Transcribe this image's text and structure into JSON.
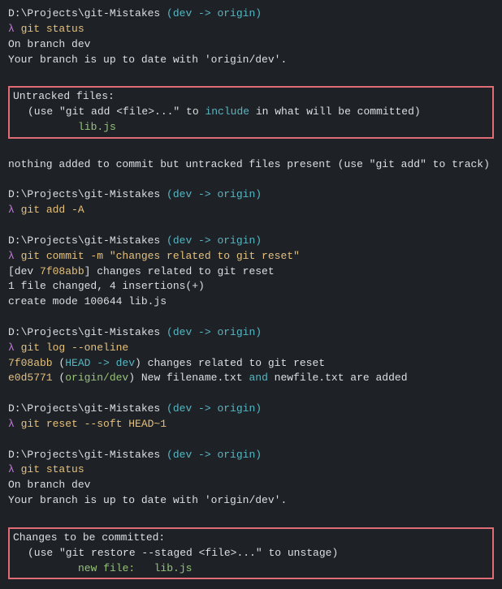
{
  "terminal": {
    "lines": [
      {
        "type": "prompt",
        "text": "D:\\Projects\\git-Mistakes (dev -> origin)"
      },
      {
        "type": "cmd",
        "text": "λ git status"
      },
      {
        "type": "normal",
        "text": "On branch dev"
      },
      {
        "type": "normal",
        "text": "Your branch is up to date with 'origin/dev'."
      },
      {
        "type": "blank"
      },
      {
        "type": "redbox_start",
        "text": "Untracked files:"
      },
      {
        "type": "redbox_line",
        "text": "  (use \"git add <file>...\" to include in what will be committed)"
      },
      {
        "type": "redbox_lib",
        "text": "        lib.js"
      },
      {
        "type": "redbox_end"
      },
      {
        "type": "blank"
      },
      {
        "type": "normal",
        "text": "nothing added to commit but untracked files present (use \"git add\" to track)"
      },
      {
        "type": "blank"
      },
      {
        "type": "prompt",
        "text": "D:\\Projects\\git-Mistakes (dev -> origin)"
      },
      {
        "type": "cmd",
        "text": "λ git add -A"
      },
      {
        "type": "blank"
      },
      {
        "type": "prompt",
        "text": "D:\\Projects\\git-Mistakes (dev -> origin)"
      },
      {
        "type": "cmd",
        "text": "λ git commit -m \"changes related to git reset\""
      },
      {
        "type": "normal",
        "text": "[dev 7f08abb] changes related to git reset"
      },
      {
        "type": "normal",
        "text": " 1 file changed, 4 insertions(+)"
      },
      {
        "type": "normal",
        "text": " create mode 100644 lib.js"
      },
      {
        "type": "blank"
      },
      {
        "type": "prompt",
        "text": "D:\\Projects\\git-Mistakes (dev -> origin)"
      },
      {
        "type": "cmd",
        "text": "λ git log --oneline"
      },
      {
        "type": "logline1",
        "text": "7f08abb (HEAD -> dev) changes related to git reset"
      },
      {
        "type": "logline2",
        "text": "e0d5771 (origin/dev) New filename.txt and newfile.txt are added"
      },
      {
        "type": "blank"
      },
      {
        "type": "prompt",
        "text": "D:\\Projects\\git-Mistakes (dev -> origin)"
      },
      {
        "type": "cmd",
        "text": "λ git reset --soft HEAD~1"
      },
      {
        "type": "blank"
      },
      {
        "type": "prompt",
        "text": "D:\\Projects\\git-Mistakes (dev -> origin)"
      },
      {
        "type": "cmd",
        "text": "λ git status"
      },
      {
        "type": "normal",
        "text": "On branch dev"
      },
      {
        "type": "normal",
        "text": "Your branch is up to date with 'origin/dev'."
      },
      {
        "type": "blank"
      },
      {
        "type": "redbox2_start",
        "text": "Changes to be committed:"
      },
      {
        "type": "redbox2_line",
        "text": "  (use \"git restore --staged <file>...\" to unstage)"
      },
      {
        "type": "redbox2_lib",
        "text": "        new file:   lib.js"
      },
      {
        "type": "redbox2_end"
      }
    ]
  }
}
